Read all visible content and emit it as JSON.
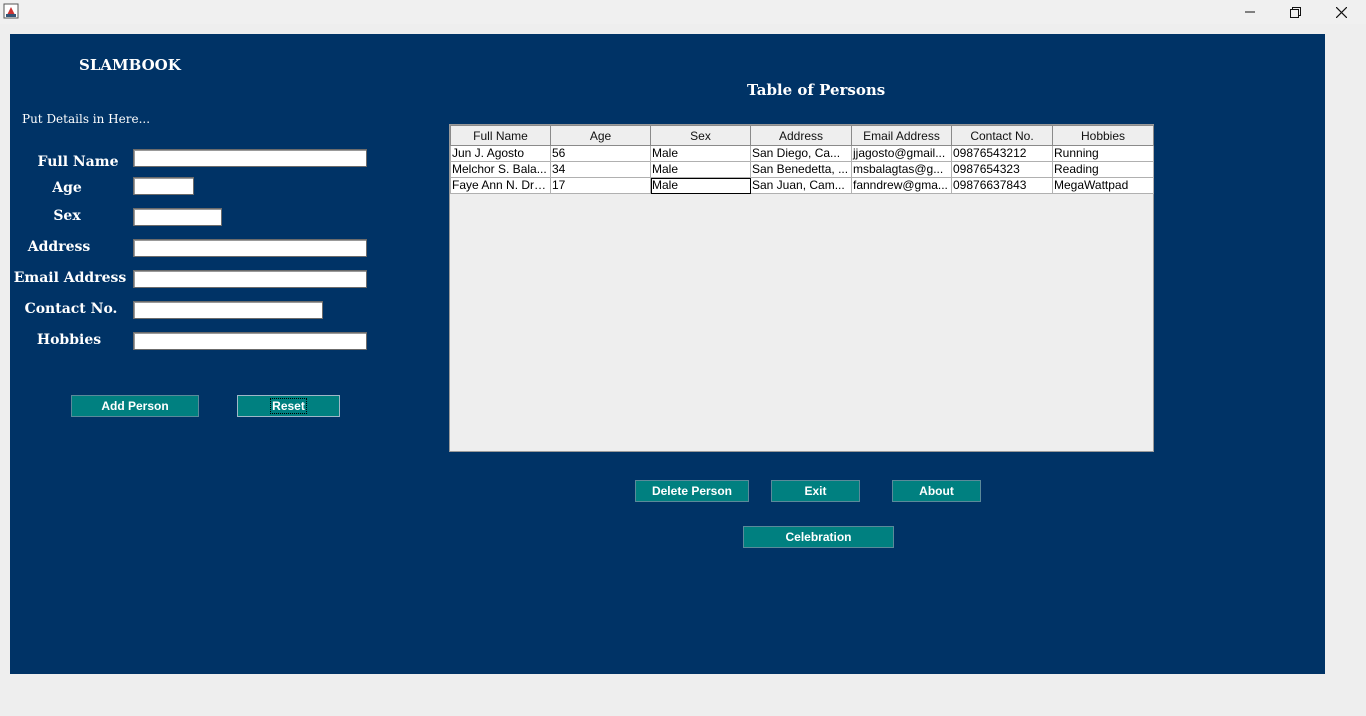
{
  "window": {
    "minimize_icon": "minimize-icon",
    "maximize_icon": "restore-icon",
    "close_icon": "close-icon"
  },
  "app": {
    "title": "SLAMBOOK",
    "subtitle": "Put Details in Here..."
  },
  "form": {
    "fields": [
      {
        "label": "Full Name",
        "value": ""
      },
      {
        "label": "Age",
        "value": ""
      },
      {
        "label": "Sex",
        "value": ""
      },
      {
        "label": "Address",
        "value": ""
      },
      {
        "label": "Email Address",
        "value": ""
      },
      {
        "label": "Contact No.",
        "value": ""
      },
      {
        "label": "Hobbies",
        "value": ""
      }
    ],
    "add_button": "Add Person",
    "reset_button": "Reset"
  },
  "table": {
    "title": "Table of Persons",
    "columns": [
      "Full Name",
      "Age",
      "Sex",
      "Address",
      "Email Address",
      "Contact No.",
      "Hobbies"
    ],
    "rows": [
      [
        "Jun J. Agosto",
        "56",
        "Male",
        "San Diego, Ca...",
        "jjagosto@gmail...",
        "09876543212",
        "Running"
      ],
      [
        "Melchor S. Bala...",
        "34",
        "Male",
        "San Benedetta, ...",
        "msbalagtas@g...",
        "0987654323",
        "Reading"
      ],
      [
        "Faye Ann N. Dre...",
        "17",
        "Male",
        "San Juan, Cam...",
        "fanndrew@gma...",
        "09876637843",
        "MegaWattpad"
      ]
    ]
  },
  "actions": {
    "delete": "Delete Person",
    "exit": "Exit",
    "about": "About",
    "celebration": "Celebration"
  },
  "colors": {
    "panel": "#003366",
    "button": "#008080"
  }
}
